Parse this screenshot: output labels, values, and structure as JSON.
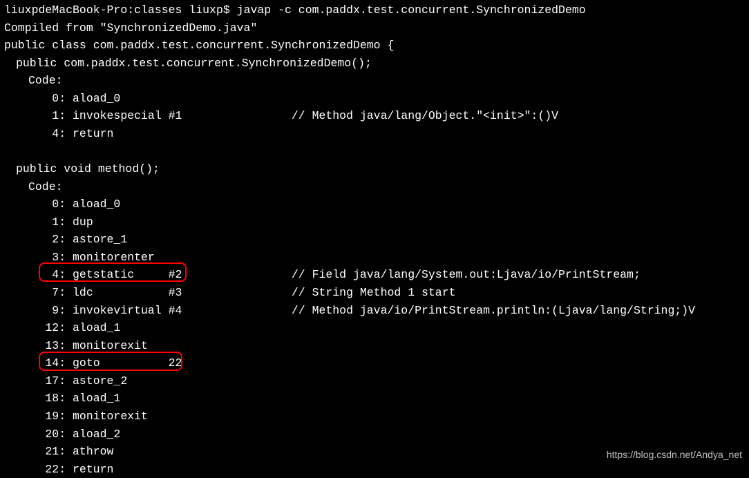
{
  "prompt": {
    "host": "liuxpdeMacBook-Pro:classes liuxp$",
    "command": "javap -c com.paddx.test.concurrent.SynchronizedDemo"
  },
  "compiled_from": "Compiled from \"SynchronizedDemo.java\"",
  "class_decl": "public class com.paddx.test.concurrent.SynchronizedDemo {",
  "constructor": {
    "signature": "public com.paddx.test.concurrent.SynchronizedDemo();",
    "code_label": "Code:",
    "instructions": [
      {
        "pc": " 0",
        "op": "aload_0",
        "arg": "",
        "comment": ""
      },
      {
        "pc": " 1",
        "op": "invokespecial",
        "arg": "#1",
        "comment": "// Method java/lang/Object.\"<init>\":()V"
      },
      {
        "pc": " 4",
        "op": "return",
        "arg": "",
        "comment": ""
      }
    ]
  },
  "method": {
    "signature": "public void method();",
    "code_label": "Code:",
    "instructions": [
      {
        "pc": " 0",
        "op": "aload_0",
        "arg": "",
        "comment": ""
      },
      {
        "pc": " 1",
        "op": "dup",
        "arg": "",
        "comment": ""
      },
      {
        "pc": " 2",
        "op": "astore_1",
        "arg": "",
        "comment": ""
      },
      {
        "pc": " 3",
        "op": "monitorenter",
        "arg": "",
        "comment": ""
      },
      {
        "pc": " 4",
        "op": "getstatic",
        "arg": "#2",
        "comment": "// Field java/lang/System.out:Ljava/io/PrintStream;"
      },
      {
        "pc": " 7",
        "op": "ldc",
        "arg": "#3",
        "comment": "// String Method 1 start"
      },
      {
        "pc": " 9",
        "op": "invokevirtual",
        "arg": "#4",
        "comment": "// Method java/io/PrintStream.println:(Ljava/lang/String;)V"
      },
      {
        "pc": "12",
        "op": "aload_1",
        "arg": "",
        "comment": ""
      },
      {
        "pc": "13",
        "op": "monitorexit",
        "arg": "",
        "comment": ""
      },
      {
        "pc": "14",
        "op": "goto",
        "arg": "22",
        "comment": ""
      },
      {
        "pc": "17",
        "op": "astore_2",
        "arg": "",
        "comment": ""
      },
      {
        "pc": "18",
        "op": "aload_1",
        "arg": "",
        "comment": ""
      },
      {
        "pc": "19",
        "op": "monitorexit",
        "arg": "",
        "comment": ""
      },
      {
        "pc": "20",
        "op": "aload_2",
        "arg": "",
        "comment": ""
      },
      {
        "pc": "21",
        "op": "athrow",
        "arg": "",
        "comment": ""
      },
      {
        "pc": "22",
        "op": "return",
        "arg": "",
        "comment": ""
      }
    ]
  },
  "watermark": "https://blog.csdn.net/Andya_net"
}
